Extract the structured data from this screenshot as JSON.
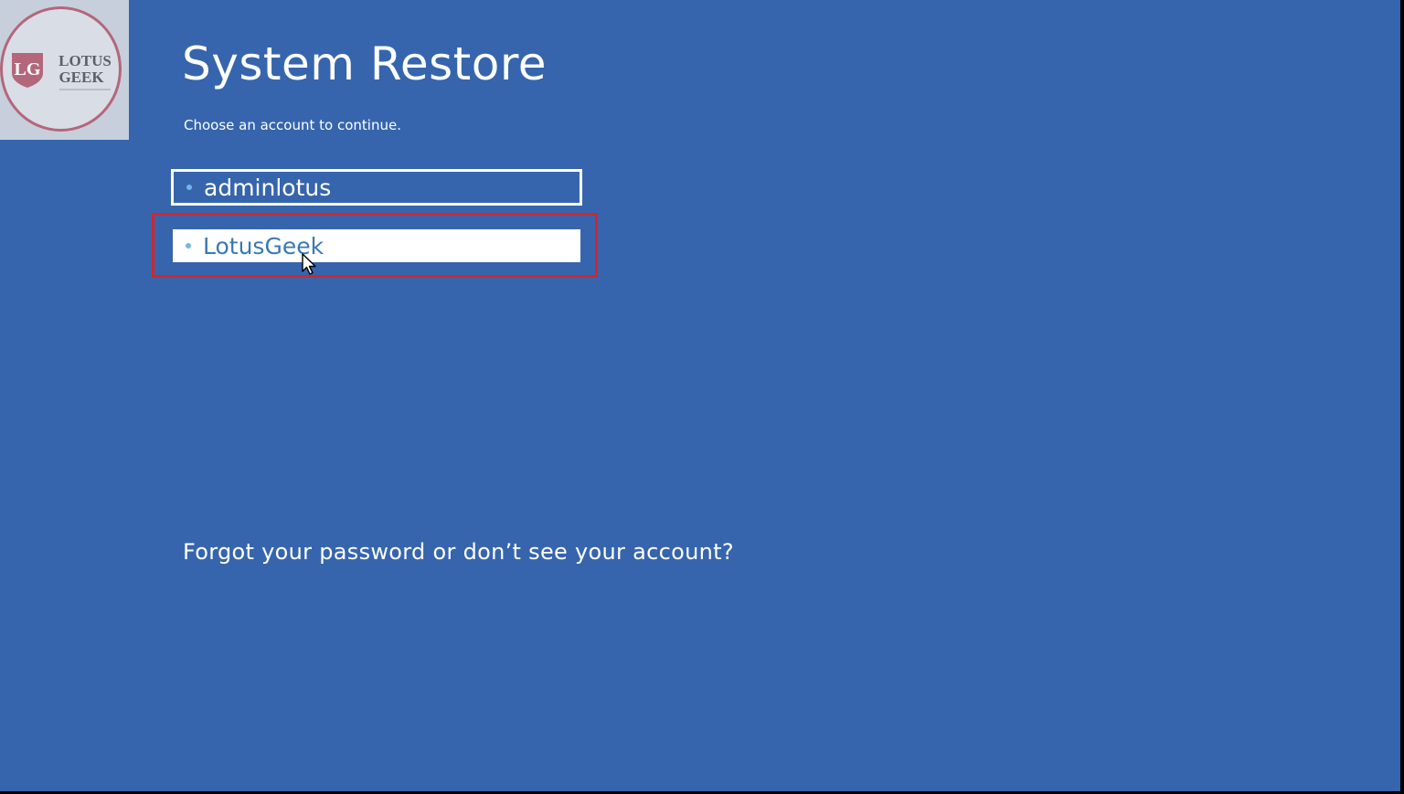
{
  "page": {
    "title": "System Restore",
    "subtitle": "Choose an account to continue."
  },
  "accounts": [
    {
      "name": "adminlotus",
      "selected": false
    },
    {
      "name": "LotusGeek",
      "selected": true
    }
  ],
  "links": {
    "forgot": "Forgot your password or don’t see your account?"
  },
  "watermark": {
    "monogram": "LG",
    "line1": "LOTUS",
    "line2": "GEEK"
  },
  "colors": {
    "background": "#3665ad",
    "highlight_box": "#d6242b",
    "selected_text": "#3a78b5"
  }
}
